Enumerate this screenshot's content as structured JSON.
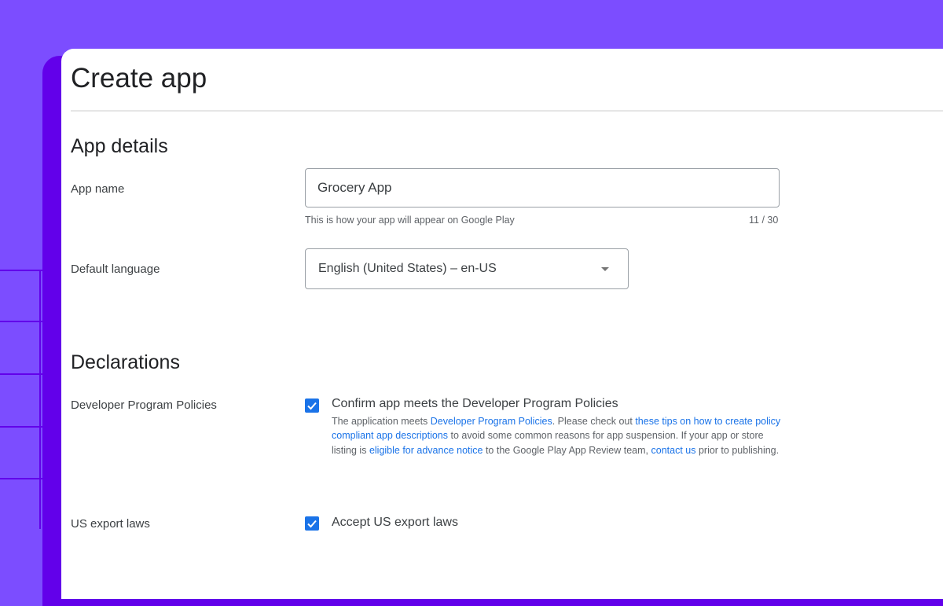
{
  "page": {
    "title": "Create app"
  },
  "app_details": {
    "heading": "App details",
    "app_name": {
      "label": "App name",
      "value": "Grocery App",
      "helper": "This is how your app will appear on Google Play",
      "counter": "11 / 30"
    },
    "default_language": {
      "label": "Default language",
      "selected": "English (United States) – en-US"
    }
  },
  "declarations": {
    "heading": "Declarations",
    "developer_policies": {
      "label": "Developer Program Policies",
      "checkbox_label": "Confirm app meets the Developer Program Policies",
      "checked": true,
      "description": {
        "t1": "The application meets ",
        "link1": "Developer Program Policies",
        "t2": ". Please check out ",
        "link2": "these tips on how to create policy compliant app descriptions",
        "t3": " to avoid some common reasons for app suspension. If your app or store listing is ",
        "link3": "eligible for advance notice",
        "t4": " to the Google Play App Review team, ",
        "link4": "contact us",
        "t5": " prior to publishing."
      }
    },
    "export_laws": {
      "label": "US export laws",
      "checkbox_label": "Accept US export laws",
      "checked": true
    }
  },
  "colors": {
    "background": "#7c4dff",
    "accent_dark": "#6200ea",
    "checkbox": "#1a73e8",
    "link": "#1a73e8"
  }
}
